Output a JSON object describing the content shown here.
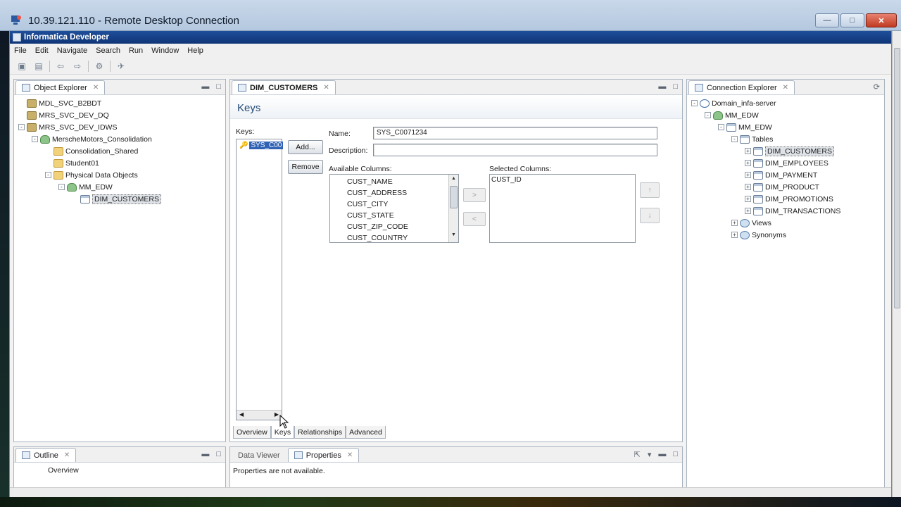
{
  "rdc": {
    "title": "10.39.121.110 - Remote Desktop Connection",
    "minimize": "—",
    "restore": "□",
    "close": "✕"
  },
  "app": {
    "title": "Informatica Developer"
  },
  "menu": [
    "File",
    "Edit",
    "Navigate",
    "Search",
    "Run",
    "Window",
    "Help"
  ],
  "object_explorer": {
    "tab": "Object Explorer",
    "tree": [
      {
        "label": "MDL_SVC_B2BDT",
        "level": 0,
        "toggle": "none",
        "icon": "model"
      },
      {
        "label": "MRS_SVC_DEV_DQ",
        "level": 0,
        "toggle": "none",
        "icon": "model"
      },
      {
        "label": "MRS_SVC_DEV_IDWS",
        "level": 0,
        "toggle": "-",
        "icon": "model"
      },
      {
        "label": "MerscheMotors_Consolidation",
        "level": 1,
        "toggle": "-",
        "icon": "db"
      },
      {
        "label": "Consolidation_Shared",
        "level": 2,
        "toggle": "none",
        "icon": "folder"
      },
      {
        "label": "Student01",
        "level": 2,
        "toggle": "none",
        "icon": "folder"
      },
      {
        "label": "Physical Data Objects",
        "level": 2,
        "toggle": "-",
        "icon": "folder"
      },
      {
        "label": "MM_EDW",
        "level": 3,
        "toggle": "-",
        "icon": "db"
      },
      {
        "label": "DIM_CUSTOMERS",
        "level": 4,
        "toggle": "none",
        "icon": "table",
        "selected": true
      }
    ]
  },
  "outline": {
    "tab": "Outline",
    "item": "Overview"
  },
  "editor": {
    "tab": "DIM_CUSTOMERS",
    "heading": "Keys",
    "keys_label": "Keys:",
    "key_item": "SYS_C00",
    "add_button": "Add...",
    "remove_button": "Remove",
    "name_label": "Name:",
    "name_value": "SYS_C0071234",
    "description_label": "Description:",
    "description_value": "",
    "available_label": "Available Columns:",
    "available_columns": [
      "CUST_NAME",
      "CUST_ADDRESS",
      "CUST_CITY",
      "CUST_STATE",
      "CUST_ZIP_CODE",
      "CUST_COUNTRY"
    ],
    "selected_label": "Selected Columns:",
    "selected_columns": [
      "CUST_ID"
    ],
    "move_right": ">",
    "move_left": "<",
    "move_up": "↑",
    "move_down": "↓",
    "bottom_tabs": [
      "Overview",
      "Keys",
      "Relationships",
      "Advanced"
    ],
    "active_bottom_tab": "Keys"
  },
  "properties": {
    "tabs": [
      "Data Viewer",
      "Properties"
    ],
    "message": "Properties are not available."
  },
  "connection_explorer": {
    "tab": "Connection Explorer",
    "tree": [
      {
        "label": "Domain_infa-server",
        "level": 0,
        "toggle": "-",
        "icon": "domain"
      },
      {
        "label": "MM_EDW",
        "level": 1,
        "toggle": "-",
        "icon": "db"
      },
      {
        "label": "MM_EDW",
        "level": 2,
        "toggle": "-",
        "icon": "table"
      },
      {
        "label": "Tables",
        "level": 3,
        "toggle": "-",
        "icon": "table"
      },
      {
        "label": "DIM_CUSTOMERS",
        "level": 4,
        "toggle": "+",
        "icon": "table",
        "selected": true
      },
      {
        "label": "DIM_EMPLOYEES",
        "level": 4,
        "toggle": "+",
        "icon": "table"
      },
      {
        "label": "DIM_PAYMENT",
        "level": 4,
        "toggle": "+",
        "icon": "table"
      },
      {
        "label": "DIM_PRODUCT",
        "level": 4,
        "toggle": "+",
        "icon": "table"
      },
      {
        "label": "DIM_PROMOTIONS",
        "level": 4,
        "toggle": "+",
        "icon": "table"
      },
      {
        "label": "DIM_TRANSACTIONS",
        "level": 4,
        "toggle": "+",
        "icon": "table"
      },
      {
        "label": "Views",
        "level": 3,
        "toggle": "+",
        "icon": "view"
      },
      {
        "label": "Synonyms",
        "level": 3,
        "toggle": "+",
        "icon": "view"
      }
    ]
  }
}
